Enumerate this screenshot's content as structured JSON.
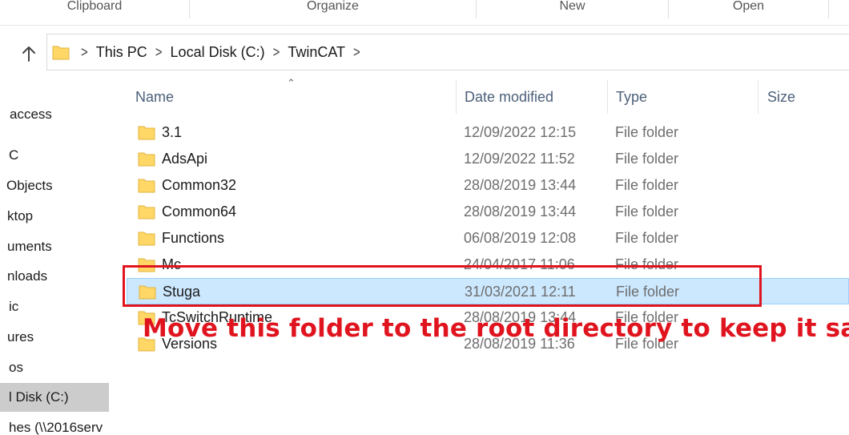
{
  "ribbon": {
    "groups": [
      "Clipboard",
      "Organize",
      "New",
      "Open"
    ]
  },
  "address": {
    "up_icon": "arrow-up-icon",
    "folder_icon": "folder-icon",
    "breadcrumbs": [
      "This PC",
      "Local Disk (C:)",
      "TwinCAT"
    ]
  },
  "nav": {
    "items": [
      "access",
      "C",
      "Objects",
      "ktop",
      "uments",
      "nloads",
      "ic",
      "ures",
      "os",
      "l Disk (C:)",
      "hes (\\\\2016serv"
    ],
    "selected_index": 9
  },
  "columns": {
    "name": "Name",
    "date": "Date modified",
    "type": "Type",
    "size": "Size",
    "sort_indicator": "^"
  },
  "files": [
    {
      "name": "3.1",
      "date": "12/09/2022 12:15",
      "type": "File folder"
    },
    {
      "name": "AdsApi",
      "date": "12/09/2022 11:52",
      "type": "File folder"
    },
    {
      "name": "Common32",
      "date": "28/08/2019 13:44",
      "type": "File folder"
    },
    {
      "name": "Common64",
      "date": "28/08/2019 13:44",
      "type": "File folder"
    },
    {
      "name": "Functions",
      "date": "06/08/2019 12:08",
      "type": "File folder"
    },
    {
      "name": "Mc",
      "date": "24/04/2017 11:06",
      "type": "File folder"
    },
    {
      "name": "Stuga",
      "date": "31/03/2021 12:11",
      "type": "File folder"
    },
    {
      "name": "TcSwitchRuntime",
      "date": "28/08/2019 13:44",
      "type": "File folder"
    },
    {
      "name": "Versions",
      "date": "28/08/2019 11:36",
      "type": "File folder"
    }
  ],
  "selected_file": "Stuga",
  "annotation": {
    "text": "Move this folder to the root directory to keep it safe",
    "color": "#e0141e"
  },
  "colors": {
    "selection_bg": "#cce8ff",
    "selection_border": "#99d1ff",
    "folder_yellow": "#ffd766",
    "header_text": "#4c607a"
  }
}
